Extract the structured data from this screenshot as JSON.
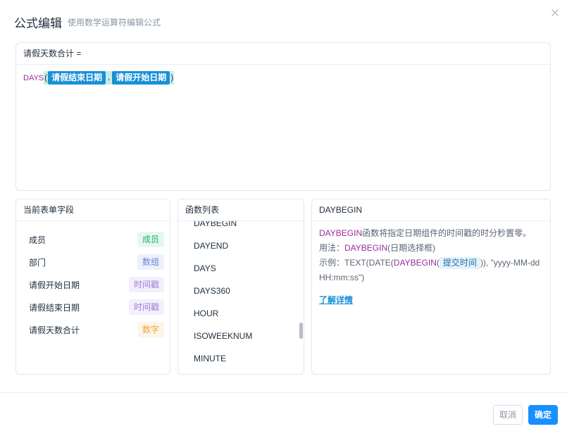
{
  "header": {
    "title": "公式编辑",
    "subtitle": "使用数学运算符编辑公式"
  },
  "editor": {
    "label": "请假天数合计 =",
    "formula": {
      "function_name": "DAYS",
      "open_paren": "(",
      "arg1": "请假结束日期",
      "separator": ",",
      "arg2": "请假开始日期",
      "close_paren": ")"
    }
  },
  "fields_panel": {
    "title": "当前表单字段",
    "items": [
      {
        "label": "成员",
        "type": "成员"
      },
      {
        "label": "部门",
        "type": "数组"
      },
      {
        "label": "请假开始日期",
        "type": "时间戳"
      },
      {
        "label": "请假结束日期",
        "type": "时间戳"
      },
      {
        "label": "请假天数合计",
        "type": "数字"
      }
    ]
  },
  "functions_panel": {
    "title": "函数列表",
    "items": [
      "DAYBEGIN",
      "DAYEND",
      "DAYS",
      "DAYS360",
      "HOUR",
      "ISOWEEKNUM",
      "MINUTE"
    ]
  },
  "detail_panel": {
    "title": "DAYBEGIN",
    "desc_fn": "DAYBEGIN",
    "desc_text": "函数将指定日期组件的时间戳的时分秒置零。",
    "usage_label": "用法：",
    "usage_fn": "DAYBEGIN",
    "usage_args": "(日期选择框)",
    "example_label": "示例：",
    "example_prefix": "TEXT(DATE(",
    "example_fn": "DAYBEGIN",
    "example_open": "(",
    "example_chip": "提交时间",
    "example_suffix": ")), \"yyyy-MM-dd HH:mm:ss\")",
    "learn_more": "了解详情"
  },
  "footer": {
    "cancel_label": "取消",
    "ok_label": "确定"
  },
  "colors": {
    "primary": "#1890ff",
    "function_keyword": "#9b2c9b"
  }
}
